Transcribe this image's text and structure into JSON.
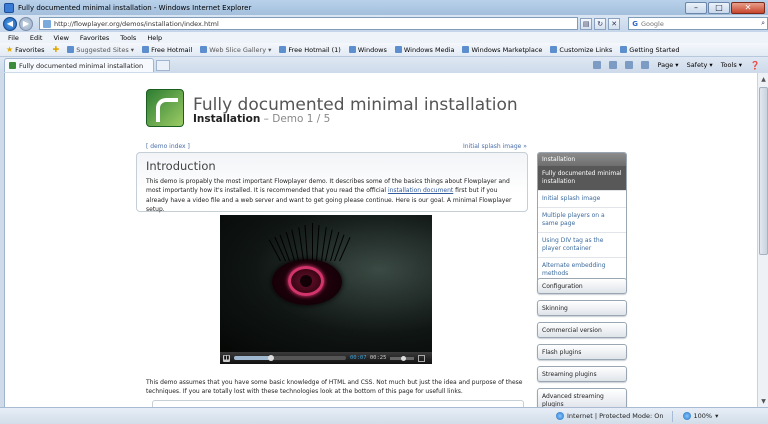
{
  "window": {
    "title": "Fully documented minimal installation - Windows Internet Explorer",
    "minimize": "–",
    "maximize": "□",
    "close": "✕"
  },
  "address": {
    "url": "http://flowplayer.org/demos/installation/index.html",
    "search_placeholder": "Google",
    "search_engine": "G"
  },
  "menu": [
    "File",
    "Edit",
    "View",
    "Favorites",
    "Tools",
    "Help"
  ],
  "favorites_bar": {
    "favorites_label": "Favorites",
    "items": [
      "Suggested Sites ▾",
      "Free Hotmail",
      "Web Slice Gallery ▾",
      "Free Hotmail (1)",
      "Windows",
      "Windows Media",
      "Windows Marketplace",
      "Customize Links",
      "Getting Started"
    ]
  },
  "tab": {
    "label": "Fully documented minimal installation"
  },
  "command_bar": [
    "Page ▾",
    "Safety ▾",
    "Tools ▾"
  ],
  "page": {
    "heading": "Fully documented minimal installation",
    "subheading_bold": "Installation",
    "subheading_rest": " – Demo 1 / 5",
    "demo_index_link": "[ demo index ]",
    "next_link": "Initial splash image »",
    "intro": {
      "title": "Introduction",
      "text_before_link": "This demo is propably the most important Flowplayer demo. It describes some of the basics things about Flowplayer and most importantly how it's installed. It is recommended that you read the official ",
      "link": "installation document",
      "text_after_link": " first but if you already have a video file and a web server and want to get going please continue. Here is our goal. A minimal Flowplayer setup."
    },
    "player": {
      "time_current": "00:07",
      "time_total": "00:25",
      "progress": 0.33,
      "play_icon": "▮▮"
    },
    "bottom_text": "This demo assumes that you have some basic knowledge of HTML and CSS. Not much but just the idea and purpose of these techniques. If you are totally lost with these technologies look at the bottom of this page for usefull links."
  },
  "sidebar": {
    "group_title": "Installation",
    "items": [
      "Fully documented minimal installation",
      "Initial splash image",
      "Multiple players on a same page",
      "Using DIV tag as the player container",
      "Alternate embedding methods"
    ],
    "sections": [
      "Configuration",
      "Skinning",
      "Commercial version",
      "Flash plugins",
      "Streaming plugins",
      "Advanced streaming plugins"
    ]
  },
  "statusbar": {
    "zone": "Internet | Protected Mode: On",
    "zoom": "100%"
  }
}
